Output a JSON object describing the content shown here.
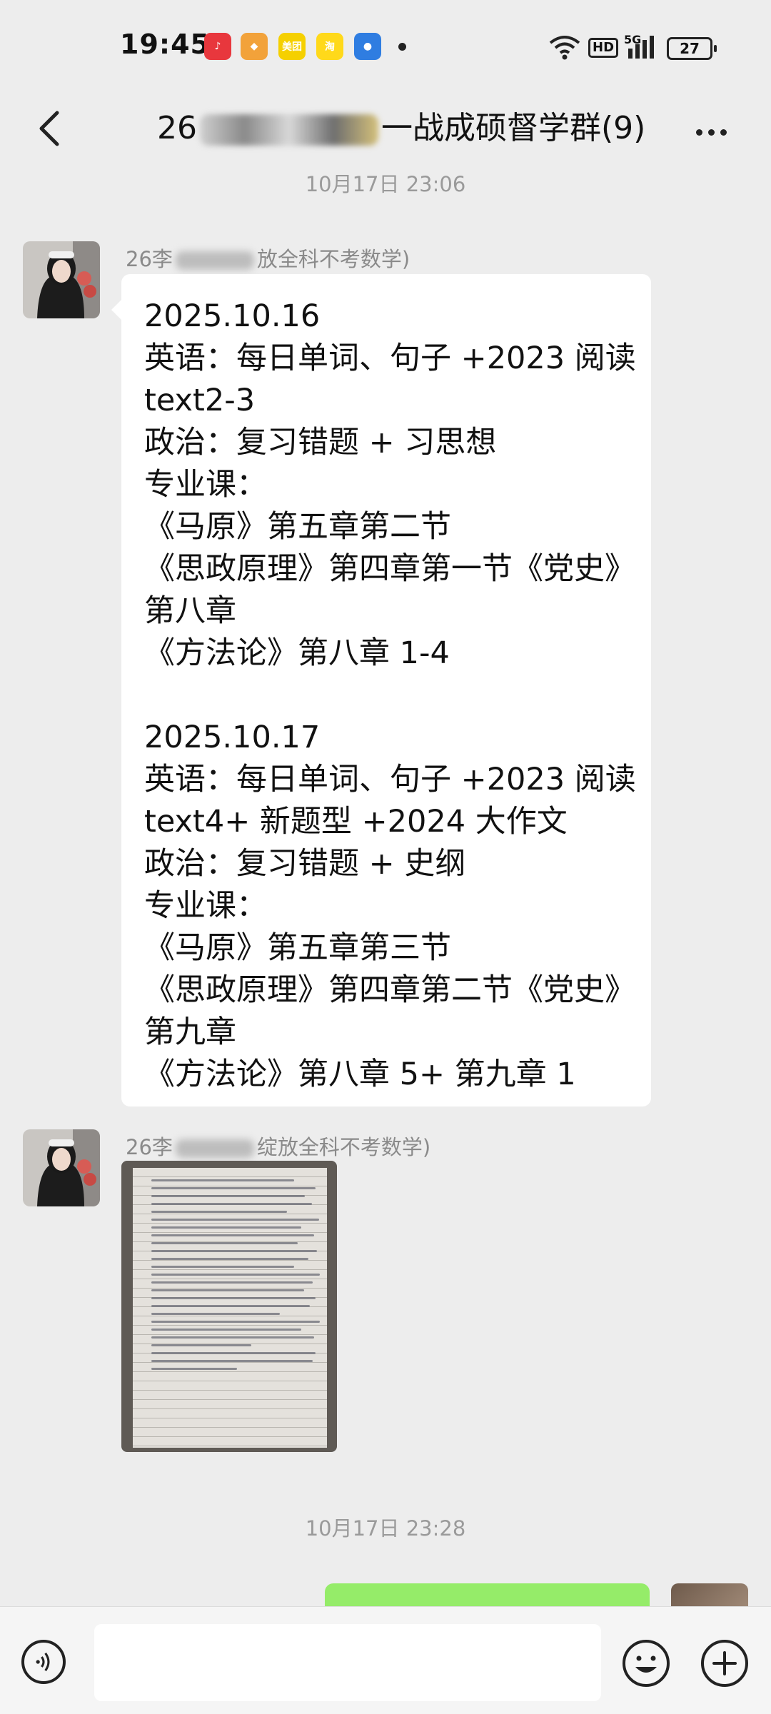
{
  "status_bar": {
    "time": "19:45",
    "apps": [
      {
        "name": "music-app-icon",
        "color": "#e8373d",
        "glyph": "♪"
      },
      {
        "name": "wallet-app-icon",
        "color": "#f2a23a",
        "glyph": "◆"
      },
      {
        "name": "meituan-app-icon",
        "color": "#f5d000",
        "glyph": "美团"
      },
      {
        "name": "delivery-app-icon",
        "color": "#ffd91a",
        "glyph": "淘"
      },
      {
        "name": "browser-app-icon",
        "color": "#2f7de1",
        "glyph": "●"
      }
    ],
    "hd": "HD",
    "network": "5G",
    "battery": "27"
  },
  "header": {
    "title_prefix": "26",
    "title_suffix": "一战成硕督学群(9)"
  },
  "messages": {
    "timestamp_1": "10月17日 23:06",
    "sender_1_prefix": "26李",
    "sender_1_suffix": "放全科不考数学)",
    "text_block_1": [
      "2025.10.16",
      "英语：每日单词、句子 +2023 阅读",
      "text2-3",
      "政治：复习错题 + 习思想",
      "专业课：",
      "《马原》第五章第二节",
      "《思政原理》第四章第一节《党史》",
      "第八章",
      "《方法论》第八章 1-4"
    ],
    "text_block_2": [
      "2025.10.17",
      "英语：每日单词、句子 +2023 阅读",
      "text4+ 新题型 +2024 大作文",
      "政治：复习错题 + 史纲",
      "专业课：",
      "《马原》第五章第三节",
      "《思政原理》第四章第二节《党史》",
      "第九章",
      "《方法论》第八章 5+ 第九章 1"
    ],
    "sender_2_prefix": "26李",
    "sender_2_suffix": "绽放全科不考数学)",
    "timestamp_2": "10月17日 23:28"
  }
}
